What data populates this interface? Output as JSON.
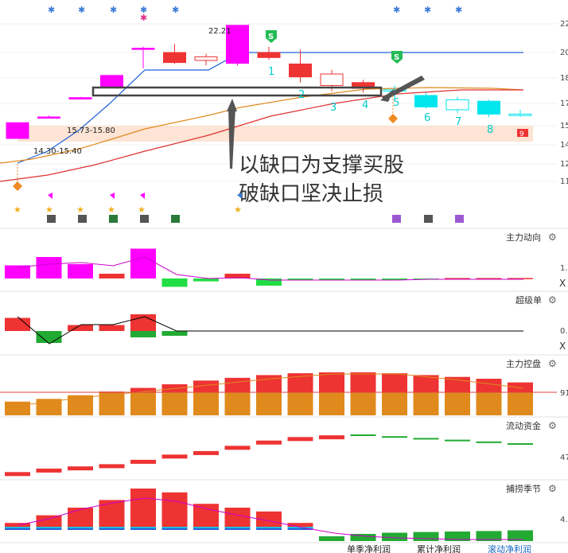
{
  "colors": {
    "up": "#ff00ff",
    "down": "#ee3333",
    "cyan": "#00e5ee",
    "blue_line": "#1e60d8",
    "orange_line": "#e08a1e",
    "red_line": "#e03030",
    "green": "#22cc44",
    "band": "#fde4d4"
  },
  "chart_data": [
    {
      "type": "candlestick",
      "y_ticks": [
        "22",
        "20",
        "18",
        "17",
        "15",
        "14",
        "12",
        "11"
      ],
      "candles": [
        {
          "o": 14.3,
          "c": 15.4,
          "h": 15.4,
          "l": 14.3,
          "color": "up"
        },
        {
          "o": 15.73,
          "c": 15.8,
          "h": 15.9,
          "l": 15.73,
          "color": "up"
        },
        {
          "o": 17.05,
          "c": 17.15,
          "h": 17.2,
          "l": 17.05,
          "color": "up"
        },
        {
          "o": 17.9,
          "c": 18.7,
          "h": 18.7,
          "l": 17.9,
          "color": "up"
        },
        {
          "o": 20.55,
          "c": 20.6,
          "h": 20.7,
          "l": 19.2,
          "color": "up"
        },
        {
          "o": 20.3,
          "c": 19.6,
          "h": 20.9,
          "l": 19.5,
          "color": "down"
        },
        {
          "o": 19.75,
          "c": 20.0,
          "h": 20.2,
          "l": 19.4,
          "color": "down_hollow"
        },
        {
          "o": 19.55,
          "c": 22.2,
          "h": 22.21,
          "l": 19.4,
          "color": "up"
        },
        {
          "o": 20.3,
          "c": 19.95,
          "h": 20.7,
          "l": 19.8,
          "color": "down"
        },
        {
          "o": 19.5,
          "c": 18.6,
          "h": 20.5,
          "l": 18.2,
          "color": "down"
        },
        {
          "o": 18.8,
          "c": 18.0,
          "h": 19.1,
          "l": 17.6,
          "color": "down_hollow"
        },
        {
          "o": 18.2,
          "c": 17.8,
          "h": 18.4,
          "l": 17.5,
          "color": "down"
        },
        {
          "o": 17.7,
          "c": 17.6,
          "h": 18.0,
          "l": 16.9,
          "color": "cyan_hollow"
        },
        {
          "o": 17.3,
          "c": 16.5,
          "h": 17.5,
          "l": 16.4,
          "color": "cyan"
        },
        {
          "o": 17.0,
          "c": 16.3,
          "h": 17.2,
          "l": 16.1,
          "color": "cyan_hollow"
        },
        {
          "o": 16.9,
          "c": 16.0,
          "h": 17.0,
          "l": 15.8,
          "color": "cyan"
        },
        {
          "o": 16.0,
          "c": 15.9,
          "h": 16.3,
          "l": 15.8,
          "color": "cyan_hollow"
        }
      ],
      "labels": [
        "1",
        "2",
        "3",
        "4",
        "5",
        "6",
        "7",
        "8"
      ],
      "price_annotations": [
        "22.21",
        "15.73-15.80",
        "14.30-15.40"
      ],
      "annotation_text": [
        "以缺口为支撑买股",
        "破缺口坚决止损"
      ]
    },
    {
      "type": "bar",
      "title": "主力动向",
      "tick": "1.",
      "values": [
        0.55,
        0.9,
        0.6,
        0.2,
        1.25,
        -0.35,
        -0.12,
        0.2,
        -0.3,
        -0.05,
        -0.05,
        -0.05,
        -0.03,
        -0.03,
        0.02,
        0.02,
        0.02
      ]
    },
    {
      "type": "bar",
      "title": "超级单",
      "tick": "0.",
      "values": [
        0.55,
        -0.5,
        0.25,
        0.25,
        0.7,
        -0.2
      ]
    },
    {
      "type": "bar",
      "title": "主力控盘",
      "tick": "91",
      "values": [
        15,
        18,
        22,
        26,
        30,
        34,
        38,
        41,
        44,
        46,
        47,
        47,
        46,
        44,
        42,
        40,
        36
      ]
    },
    {
      "type": "bar",
      "title": "流动资金",
      "tick": "47",
      "values": [
        -0.3,
        0.1,
        0.35,
        0.6,
        1.1,
        1.7,
        2.1,
        2.7,
        3.3,
        3.7,
        3.9,
        4.0,
        3.8,
        3.6,
        3.4,
        3.2,
        3.0
      ]
    },
    {
      "type": "bar",
      "title": "捕捞季节",
      "tick": "4.",
      "values": [
        0.1,
        0.3,
        0.5,
        0.7,
        1.0,
        0.9,
        0.6,
        0.5,
        0.4,
        0.1,
        -0.2,
        -0.3,
        -0.35,
        -0.38,
        -0.4,
        -0.42,
        -0.45
      ]
    }
  ],
  "bottom_tabs": [
    "单季净利润",
    "累计净利润",
    "滚动净利润"
  ]
}
